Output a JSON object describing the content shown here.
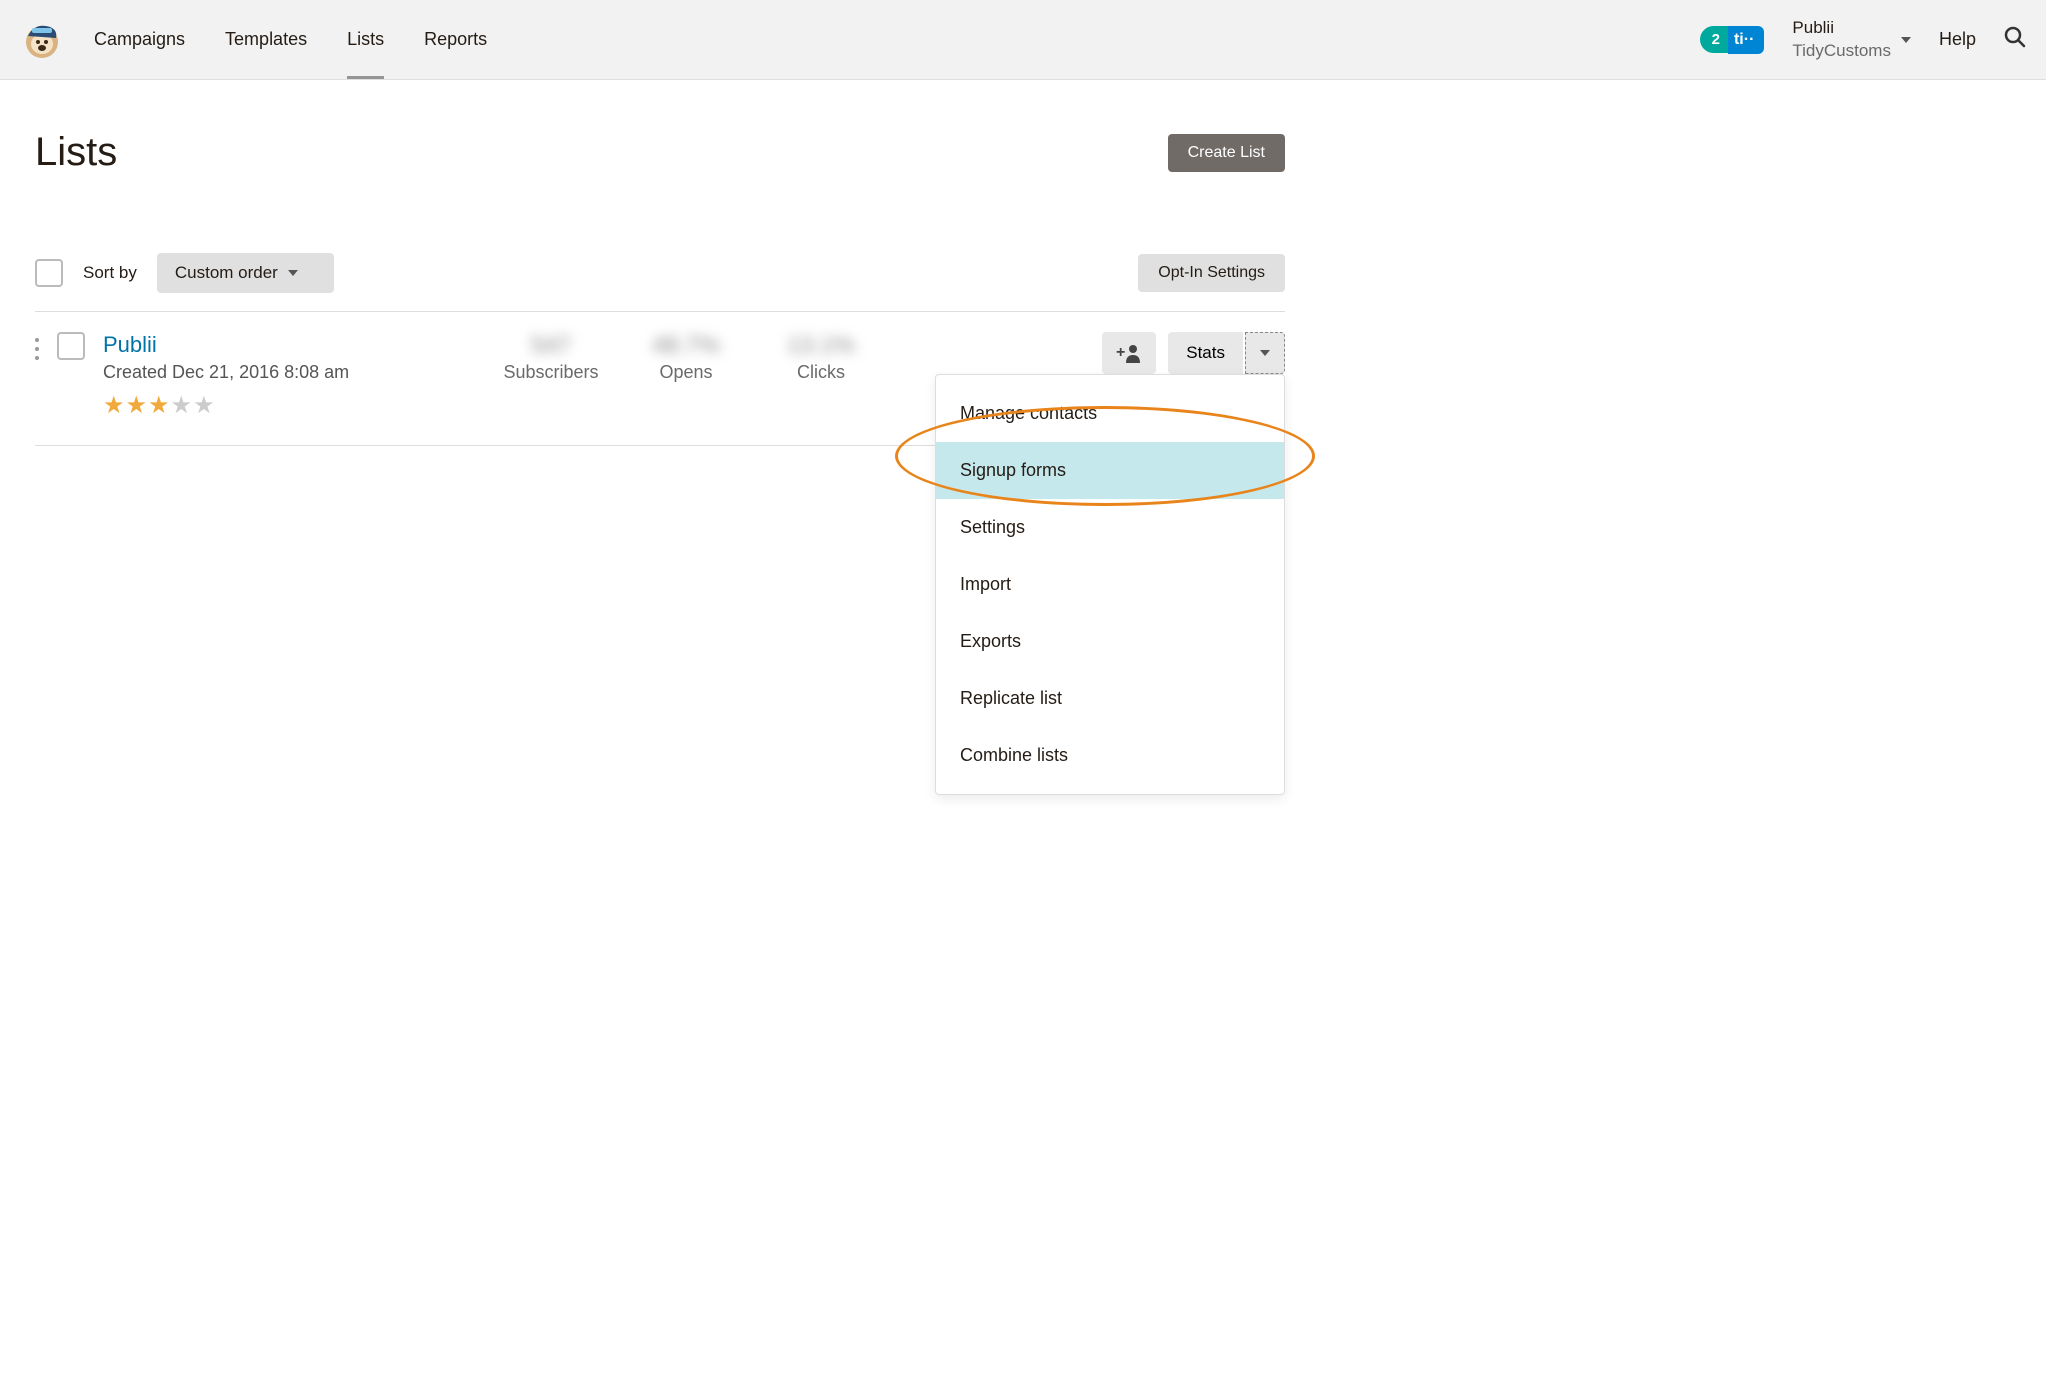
{
  "header": {
    "nav": {
      "campaigns": "Campaigns",
      "templates": "Templates",
      "lists": "Lists",
      "reports": "Reports"
    },
    "badge_count": "2",
    "badge_text": "ti··",
    "account_name": "Publii",
    "account_sub": "TidyCustoms",
    "help": "Help"
  },
  "page": {
    "title": "Lists",
    "create_button": "Create List"
  },
  "toolbar": {
    "sort_label": "Sort by",
    "sort_value": "Custom order",
    "optin_button": "Opt-In Settings"
  },
  "list": {
    "name": "Publii",
    "created": "Created Dec 21, 2016 8:08 am",
    "metrics": {
      "subscribers": {
        "value": "547",
        "label": "Subscribers"
      },
      "opens": {
        "value": "48.7%",
        "label": "Opens"
      },
      "clicks": {
        "value": "13.1%",
        "label": "Clicks"
      }
    },
    "stats_button": "Stats"
  },
  "dropdown": {
    "manage_contacts": "Manage contacts",
    "signup_forms": "Signup forms",
    "settings": "Settings",
    "import": "Import",
    "exports": "Exports",
    "replicate": "Replicate list",
    "combine": "Combine lists"
  }
}
